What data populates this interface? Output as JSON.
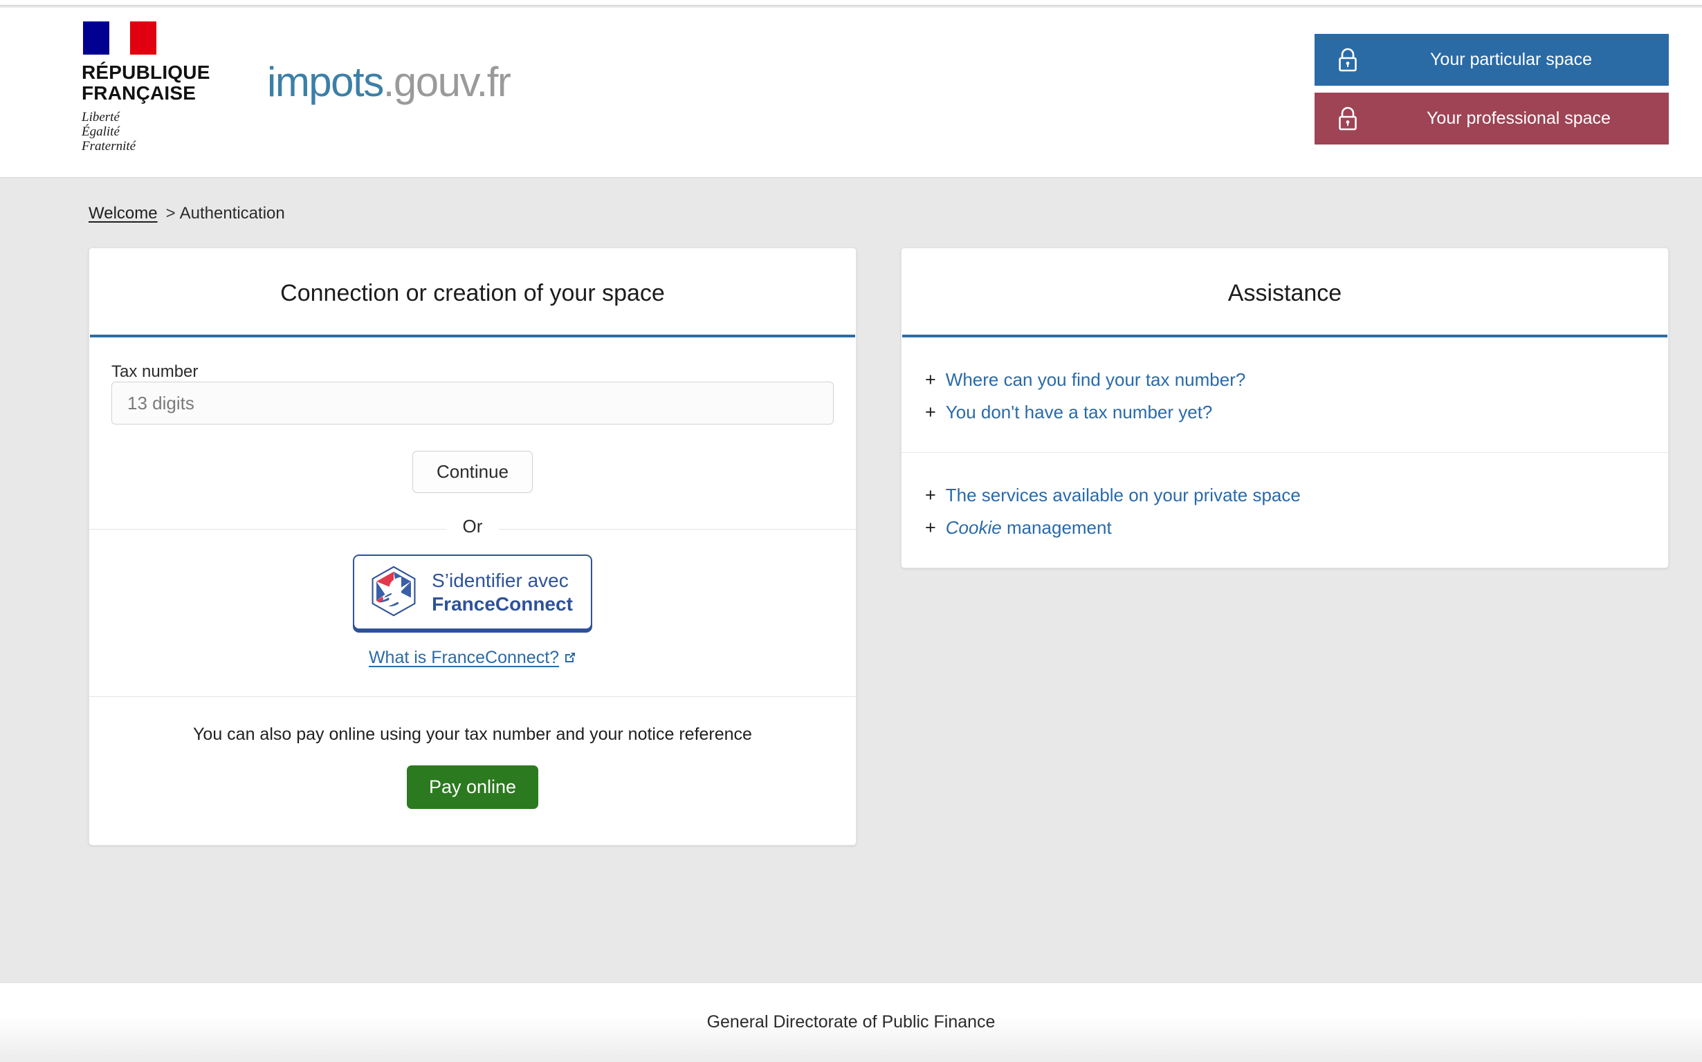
{
  "header": {
    "republic_title": "RÉPUBLIQUE\nFRANÇAISE",
    "republic_line1": "RÉPUBLIQUE",
    "republic_line2": "FRANÇAISE",
    "motto_line1": "Liberté",
    "motto_line2": "Égalité",
    "motto_line3": "Fraternité",
    "wordmark_blue": "impots",
    "wordmark_gray": ".gouv.fr",
    "particular_space_label": "Your particular space",
    "professional_space_label": "Your professional space",
    "lock_icon": "lock-icon",
    "marianne_icon": "marianne-flag-icon"
  },
  "breadcrumb": {
    "home_label": "Welcome",
    "separator": ">",
    "current_label": "Authentication"
  },
  "login_card": {
    "title": "Connection or creation of your space",
    "tax_number_label": "Tax number",
    "tax_number_placeholder": "13 digits",
    "tax_number_value": "",
    "continue_label": "Continue",
    "or_label": "Or",
    "franceconnect_line1": "S’identifier avec",
    "franceconnect_line2": "FranceConnect",
    "franceconnect_logo_icon": "franceconnect-marianne-icon",
    "what_is_franceconnect_label": "What is FranceConnect?",
    "external_link_icon": "external-link-icon",
    "pay_online_text": "You can also pay online using your tax number and your notice reference",
    "pay_online_label": "Pay online"
  },
  "assistance_card": {
    "title": "Assistance",
    "groups": [
      {
        "items": [
          {
            "plus": "+",
            "label": "Where can you find your tax number?"
          },
          {
            "plus": "+",
            "label": "You don't have a tax number yet?"
          }
        ]
      },
      {
        "items": [
          {
            "plus": "+",
            "label": "The services available on your private space"
          },
          {
            "plus": "+",
            "label_italic": "Cookie",
            "label_rest": " management"
          }
        ]
      }
    ]
  },
  "footer": {
    "text": "General Directorate of Public Finance"
  },
  "colors": {
    "particular_blue": "#2a6ba6",
    "professional_red": "#9e4455",
    "accent_rule_blue": "#2c6da4",
    "link_blue": "#2a6aa8",
    "pay_green": "#2c7a1f",
    "wordmark_blue": "#3c7fa6",
    "wordmark_gray": "#9a9a9a",
    "page_background": "#e8e8e8",
    "flag_blue": "#000091",
    "flag_red": "#e1000f"
  }
}
